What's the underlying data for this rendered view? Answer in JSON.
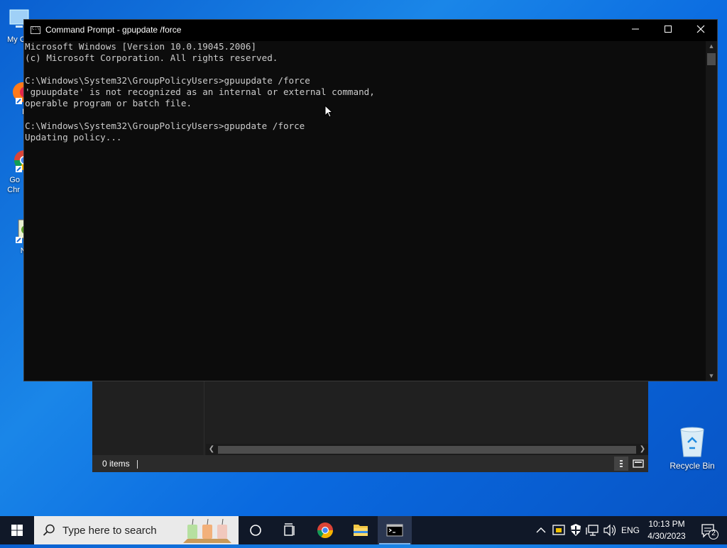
{
  "desktop": {
    "icons": [
      {
        "label": "My Co"
      },
      {
        "label": "Fir"
      },
      {
        "label": "Go Chr"
      },
      {
        "label": "Note"
      }
    ],
    "recycle_bin": "Recycle Bin"
  },
  "explorer": {
    "status_text": "0 items"
  },
  "cmd": {
    "title": "Command Prompt - gpupdate  /force",
    "lines": [
      "Microsoft Windows [Version 10.0.19045.2006]",
      "(c) Microsoft Corporation. All rights reserved.",
      "",
      "C:\\Windows\\System32\\GroupPolicyUsers>gpuupdate /force",
      "'gpuupdate' is not recognized as an internal or external command,",
      "operable program or batch file.",
      "",
      "C:\\Windows\\System32\\GroupPolicyUsers>gpupdate /force",
      "Updating policy..."
    ]
  },
  "taskbar": {
    "search_placeholder": "Type here to search",
    "language": "ENG",
    "time": "10:13 PM",
    "date": "4/30/2023",
    "notification_count": "2"
  },
  "colors": {
    "accent": "#0a6ae0",
    "console_bg": "#0c0c0c",
    "console_text": "#cccccc",
    "taskbar": "#101828"
  }
}
